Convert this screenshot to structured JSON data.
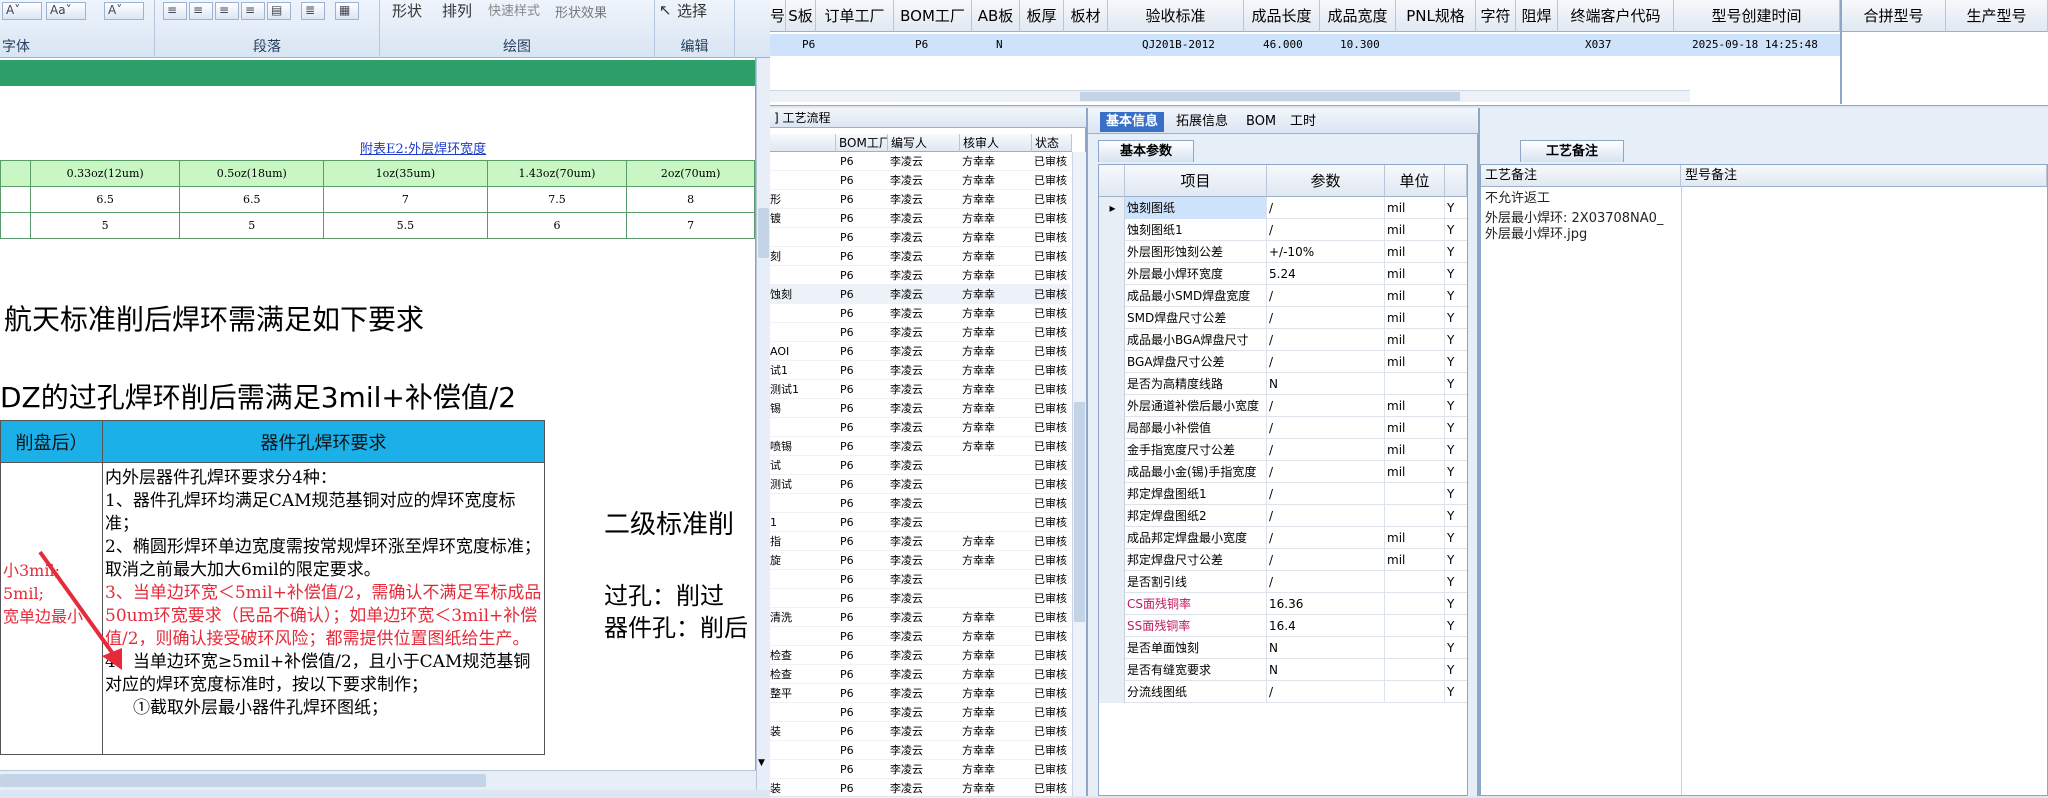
{
  "ribbon": {
    "groups": [
      {
        "label": "字体"
      },
      {
        "label": "段落"
      },
      {
        "label": "绘图"
      },
      {
        "label": "编辑"
      }
    ],
    "drawing": {
      "shape_label": "形状",
      "arrange_label": "排列",
      "quick_style_label": "快速样式",
      "shape_effect_label": "形状效果"
    },
    "edit": {
      "select_label": "选择"
    }
  },
  "doc": {
    "table1": {
      "caption": "附表E2:外层焊环宽度",
      "headers": [
        "0.33oz(12um)",
        "0.5oz(18um)",
        "1oz(35um)",
        "1.43oz(70um)",
        "2oz(70um)"
      ],
      "rows": [
        [
          "6.5",
          "6.5",
          "7",
          "7.5",
          "8"
        ],
        [
          "5",
          "5",
          "5.5",
          "6",
          "7"
        ]
      ]
    },
    "heading1": "航天标准削后焊环需满足如下要求",
    "heading2": "DZ的过孔焊环削后需满足3mil+补偿值/2",
    "table2": {
      "col1_header": "削盘后）",
      "col2_header": "器件孔焊环要求",
      "left_col": [
        "小3mil;",
        "5mil;",
        "宽单边最小"
      ],
      "lines": [
        "内外层器件孔焊环要求分4种：",
        "1、器件孔焊环均满足CAM规范基铜对应的焊环宽度标准；",
        "2、椭圆形焊环单边宽度需按常规焊环涨至焊环宽度标准；取消之前最大加大6mil的限定要求。",
        "3、当单边环宽＜5mil+补偿值/2，需确认不满足军标成品50um环宽要求（民品不确认）；如单边环宽＜3mil+补偿值/2，则确认接受破环风险；都需提供位置图纸给生产。",
        "4、当单边环宽≥5mil+补偿值/2，且小于CAM规范基铜对应的焊环宽度标准时，按以下要求制作；",
        "①截取外层最小器件孔焊环图纸；"
      ]
    },
    "right_heading": "二级标准削",
    "right_lines": [
      "过孔：削过",
      "器件孔：削后"
    ]
  },
  "topgrid": {
    "headers": [
      "号",
      "S板",
      "订单工厂",
      "BOM工厂",
      "AB板",
      "板厚",
      "板材",
      "验收标准",
      "成品长度",
      "成品宽度",
      "PNL规格",
      "字符",
      "阻焊",
      "终端客户代码",
      "型号创建时间",
      "合拼型号",
      "生产型号"
    ],
    "row": {
      "s_board": "P6",
      "order_factory": "P6",
      "ab_board": "N",
      "standard": "QJ201B-2012",
      "length": "46.000",
      "width": "10.300",
      "customer": "X037",
      "created": "2025-09-18 14:25:48"
    }
  },
  "process": {
    "tab_label": "] 工艺流程",
    "headers": [
      "BOM工厂",
      "编写人",
      "核审人",
      "状态"
    ],
    "rows": [
      {
        "name": "",
        "factory": "P6",
        "writer": "李凌云",
        "reviewer": "方幸幸",
        "status": "已审核"
      },
      {
        "name": "",
        "factory": "P6",
        "writer": "李凌云",
        "reviewer": "方幸幸",
        "status": "已审核"
      },
      {
        "name": "形",
        "factory": "P6",
        "writer": "李凌云",
        "reviewer": "方幸幸",
        "status": "已审核"
      },
      {
        "name": "镀",
        "factory": "P6",
        "writer": "李凌云",
        "reviewer": "方幸幸",
        "status": "已审核"
      },
      {
        "name": "",
        "factory": "P6",
        "writer": "李凌云",
        "reviewer": "方幸幸",
        "status": "已审核"
      },
      {
        "name": "刻",
        "factory": "P6",
        "writer": "李凌云",
        "reviewer": "方幸幸",
        "status": "已审核"
      },
      {
        "name": "",
        "factory": "P6",
        "writer": "李凌云",
        "reviewer": "方幸幸",
        "status": "已审核"
      },
      {
        "name": "蚀刻",
        "factory": "P6",
        "writer": "李凌云",
        "reviewer": "方幸幸",
        "status": "已审核"
      },
      {
        "name": "",
        "factory": "P6",
        "writer": "李凌云",
        "reviewer": "方幸幸",
        "status": "已审核"
      },
      {
        "name": "",
        "factory": "P6",
        "writer": "李凌云",
        "reviewer": "方幸幸",
        "status": "已审核"
      },
      {
        "name": "AOI",
        "factory": "P6",
        "writer": "李凌云",
        "reviewer": "方幸幸",
        "status": "已审核"
      },
      {
        "name": "试1",
        "factory": "P6",
        "writer": "李凌云",
        "reviewer": "方幸幸",
        "status": "已审核"
      },
      {
        "name": "测试1",
        "factory": "P6",
        "writer": "李凌云",
        "reviewer": "方幸幸",
        "status": "已审核"
      },
      {
        "name": "锡",
        "factory": "P6",
        "writer": "李凌云",
        "reviewer": "方幸幸",
        "status": "已审核"
      },
      {
        "name": "",
        "factory": "P6",
        "writer": "李凌云",
        "reviewer": "方幸幸",
        "status": "已审核"
      },
      {
        "name": "喷锡",
        "factory": "P6",
        "writer": "李凌云",
        "reviewer": "方幸幸",
        "status": "已审核"
      },
      {
        "name": "试",
        "factory": "P6",
        "writer": "李凌云",
        "reviewer": "",
        "status": "已审核"
      },
      {
        "name": "测试",
        "factory": "P6",
        "writer": "李凌云",
        "reviewer": "",
        "status": "已审核"
      },
      {
        "name": "",
        "factory": "P6",
        "writer": "李凌云",
        "reviewer": "",
        "status": "已审核"
      },
      {
        "name": "1",
        "factory": "P6",
        "writer": "李凌云",
        "reviewer": "",
        "status": "已审核"
      },
      {
        "name": "指",
        "factory": "P6",
        "writer": "李凌云",
        "reviewer": "方幸幸",
        "status": "已审核"
      },
      {
        "name": "旋",
        "factory": "P6",
        "writer": "李凌云",
        "reviewer": "方幸幸",
        "status": "已审核"
      },
      {
        "name": "",
        "factory": "P6",
        "writer": "李凌云",
        "reviewer": "",
        "status": "已审核"
      },
      {
        "name": "",
        "factory": "P6",
        "writer": "李凌云",
        "reviewer": "",
        "status": "已审核"
      },
      {
        "name": "清洗",
        "factory": "P6",
        "writer": "李凌云",
        "reviewer": "方幸幸",
        "status": "已审核"
      },
      {
        "name": "",
        "factory": "P6",
        "writer": "李凌云",
        "reviewer": "方幸幸",
        "status": "已审核"
      },
      {
        "name": "检查",
        "factory": "P6",
        "writer": "李凌云",
        "reviewer": "方幸幸",
        "status": "已审核"
      },
      {
        "name": "检查",
        "factory": "P6",
        "writer": "李凌云",
        "reviewer": "方幸幸",
        "status": "已审核"
      },
      {
        "name": "整平",
        "factory": "P6",
        "writer": "李凌云",
        "reviewer": "方幸幸",
        "status": "已审核"
      },
      {
        "name": "",
        "factory": "P6",
        "writer": "李凌云",
        "reviewer": "方幸幸",
        "status": "已审核"
      },
      {
        "name": "装",
        "factory": "P6",
        "writer": "李凌云",
        "reviewer": "方幸幸",
        "status": "已审核"
      },
      {
        "name": "",
        "factory": "P6",
        "writer": "李凌云",
        "reviewer": "方幸幸",
        "status": "已审核"
      },
      {
        "name": "",
        "factory": "P6",
        "writer": "李凌云",
        "reviewer": "方幸幸",
        "status": "已审核"
      },
      {
        "name": "装",
        "factory": "P6",
        "writer": "李凌云",
        "reviewer": "方幸幸",
        "status": "已审核"
      }
    ]
  },
  "basic": {
    "tabs": [
      "基本信息",
      "拓展信息",
      "BOM",
      "工时"
    ],
    "subtab": "基本参数",
    "headers": [
      "项目",
      "参数",
      "单位"
    ],
    "rows": [
      {
        "name": "蚀刻图纸",
        "value": "/",
        "unit": "mil",
        "flag": "Y"
      },
      {
        "name": "蚀刻图纸1",
        "value": "/",
        "unit": "mil",
        "flag": "Y"
      },
      {
        "name": "外层图形蚀刻公差",
        "value": "+/-10%",
        "unit": "mil",
        "flag": "Y"
      },
      {
        "name": "外层最小焊环宽度",
        "value": "5.24",
        "unit": "mil",
        "flag": "Y"
      },
      {
        "name": "成品最小SMD焊盘宽度",
        "value": "/",
        "unit": "mil",
        "flag": "Y"
      },
      {
        "name": "SMD焊盘尺寸公差",
        "value": "/",
        "unit": "mil",
        "flag": "Y"
      },
      {
        "name": "成品最小BGA焊盘尺寸",
        "value": "/",
        "unit": "mil",
        "flag": "Y"
      },
      {
        "name": "BGA焊盘尺寸公差",
        "value": "/",
        "unit": "mil",
        "flag": "Y"
      },
      {
        "name": "是否为高精度线路",
        "value": "N",
        "unit": "",
        "flag": "Y"
      },
      {
        "name": "外层通道补偿后最小宽度",
        "value": "/",
        "unit": "mil",
        "flag": "Y"
      },
      {
        "name": "局部最小补偿值",
        "value": "/",
        "unit": "mil",
        "flag": "Y"
      },
      {
        "name": "金手指宽度尺寸公差",
        "value": "/",
        "unit": "mil",
        "flag": "Y"
      },
      {
        "name": "成品最小金(锡)手指宽度",
        "value": "/",
        "unit": "mil",
        "flag": "Y"
      },
      {
        "name": "邦定焊盘图纸1",
        "value": "/",
        "unit": "",
        "flag": "Y"
      },
      {
        "name": "邦定焊盘图纸2",
        "value": "/",
        "unit": "",
        "flag": "Y"
      },
      {
        "name": "成品邦定焊盘最小宽度",
        "value": "/",
        "unit": "mil",
        "flag": "Y"
      },
      {
        "name": "邦定焊盘尺寸公差",
        "value": "/",
        "unit": "mil",
        "flag": "Y"
      },
      {
        "name": "是否割引线",
        "value": "/",
        "unit": "",
        "flag": "Y"
      },
      {
        "name": "CS面残铜率",
        "value": "16.36",
        "unit": "",
        "flag": "Y",
        "highlight": true
      },
      {
        "name": "SS面残铜率",
        "value": "16.4",
        "unit": "",
        "flag": "Y",
        "highlight": true
      },
      {
        "name": "是否单面蚀刻",
        "value": "N",
        "unit": "",
        "flag": "Y"
      },
      {
        "name": "是否有缝宽要求",
        "value": "N",
        "unit": "",
        "flag": "Y"
      },
      {
        "name": "分流线图纸",
        "value": "/",
        "unit": "",
        "flag": "Y"
      }
    ]
  },
  "notes": {
    "tab": "工艺备注",
    "col1": "工艺备注",
    "col2": "型号备注",
    "note1": "不允许返工",
    "note2": "外层最小焊环: 2X03708NA0_外层最小焊环.jpg"
  },
  "colors": {
    "accent_blue": "#3a6fc7",
    "cyan_header": "#1cb0e8",
    "green_band": "#2e9e6a",
    "red_text": "#e52b3a"
  }
}
